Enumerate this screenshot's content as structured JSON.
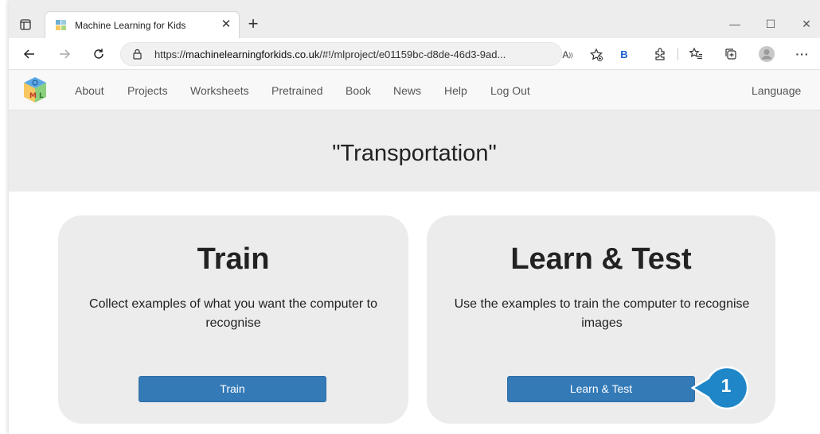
{
  "browser": {
    "tab_title": "Machine Learning for Kids",
    "url_prefix": "https://",
    "url_domain": "machinelearningforkids.co.uk",
    "url_path": "/#!/mlproject/e01159bc-d8de-46d3-9ad...",
    "bing_label": "B"
  },
  "site_nav": {
    "links": [
      "About",
      "Projects",
      "Worksheets",
      "Pretrained",
      "Book",
      "News",
      "Help",
      "Log Out"
    ],
    "language": "Language"
  },
  "page": {
    "title": "\"Transportation\""
  },
  "cards": [
    {
      "title": "Train",
      "description": "Collect examples of what you want the computer to recognise",
      "button": "Train"
    },
    {
      "title": "Learn & Test",
      "description": "Use the examples to train the computer to recognise images",
      "button": "Learn & Test"
    }
  ],
  "callout": {
    "number": "1",
    "color": "#1f86c8"
  },
  "colors": {
    "primary_button": "#337ab7",
    "card_bg": "#ececec"
  }
}
